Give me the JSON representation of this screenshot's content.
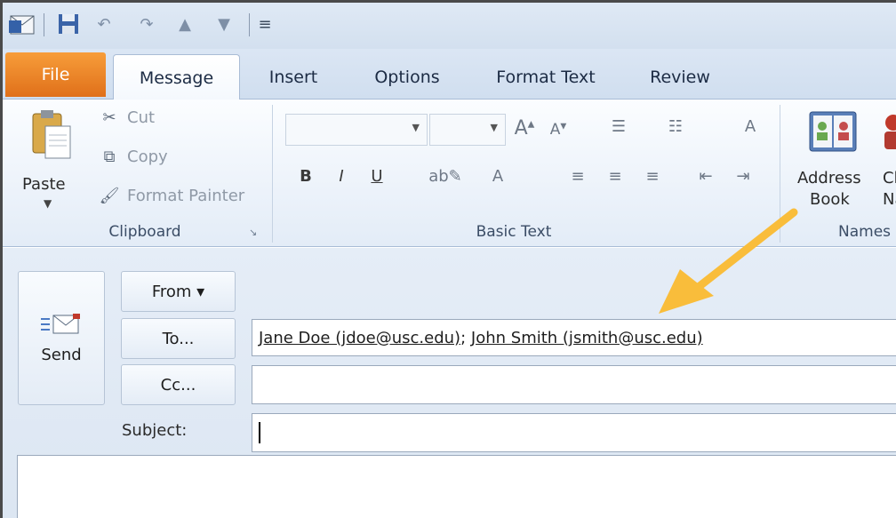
{
  "qat": {
    "icons": [
      "outlook-icon",
      "save-icon",
      "undo-icon",
      "redo-icon",
      "previous-item-icon",
      "next-item-icon",
      "customize-qat-icon"
    ]
  },
  "tabs": [
    {
      "label": "File"
    },
    {
      "label": "Message"
    },
    {
      "label": "Insert"
    },
    {
      "label": "Options"
    },
    {
      "label": "Format Text"
    },
    {
      "label": "Review"
    }
  ],
  "clipboard": {
    "paste": "Paste",
    "cut": "Cut",
    "copy": "Copy",
    "format_painter": "Format Painter",
    "label": "Clipboard"
  },
  "basic_text": {
    "font_name": "",
    "font_size": "",
    "bold": "B",
    "italic": "I",
    "underline": "U",
    "grow_font": "A",
    "shrink_font": "A",
    "font_color": "A",
    "label": "Basic Text"
  },
  "names": {
    "address_book_line1": "Address",
    "address_book_line2": "Book",
    "check_names_line1": "Ch",
    "check_names_line2": "Na",
    "label": "Names"
  },
  "compose": {
    "send": "Send",
    "from": "From ▾",
    "to": "To...",
    "cc": "Cc...",
    "subject_label": "Subject:",
    "recipient_1": "Jane Doe (jdoe@usc.edu)",
    "separator": ";",
    "recipient_2": "John Smith (jsmith@usc.edu)",
    "cc_value": "",
    "subject_value": ""
  },
  "colors": {
    "file_tab": "#e8801f",
    "arrow": "#f9bd3b",
    "ribbon_bg": "#eef3fa"
  }
}
